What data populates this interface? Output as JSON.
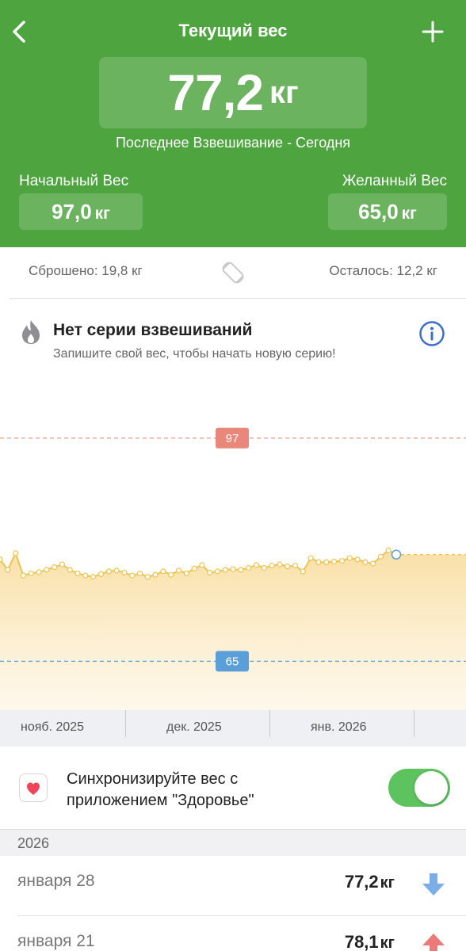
{
  "header": {
    "title": "Текущий вес",
    "current_weight": "77,2",
    "unit": "кг",
    "last_weigh_in": "Последнее Взвешивание - Сегодня",
    "start_label": "Начальный Вес",
    "start_value": "97,0",
    "goal_label": "Желанный Вес",
    "goal_value": "65,0"
  },
  "stats": {
    "lost": "Сброшено: 19,8 кг",
    "remaining": "Осталось: 12,2 кг"
  },
  "streak": {
    "title": "Нет серии взвешиваний",
    "subtitle": "Запишите свой вес, чтобы начать новую серию!"
  },
  "chart_data": {
    "type": "area",
    "x_labels": [
      "нояб. 2025",
      "дек. 2025",
      "янв. 2026"
    ],
    "reference_lines": [
      {
        "label": "97",
        "value": 97,
        "color": "#e8877a"
      },
      {
        "label": "65",
        "value": 65,
        "color": "#5b9fd8"
      }
    ],
    "series": [
      {
        "values": [
          79.6,
          78.1,
          80.5,
          77.3,
          77.6,
          77.8,
          78.1,
          78.5,
          78.9,
          78.1,
          77.6,
          77.3,
          77.1,
          77.5,
          77.9,
          78.0,
          77.7,
          77.3,
          77.6,
          77.1,
          77.4,
          77.9,
          77.4,
          78.0,
          77.6,
          78.3,
          78.8,
          77.7,
          77.9,
          78.1,
          78.2,
          78.1,
          78.4,
          78.8,
          78.4,
          78.7,
          78.9,
          78.6,
          78.7,
          77.9,
          79.8,
          79.2,
          79.2,
          79.3,
          79.4,
          79.8,
          79.6,
          79.2,
          79.0,
          80.0,
          80.9,
          80.3
        ],
        "color": "#f1c34d"
      }
    ],
    "current_point": 80.3,
    "ylim": [
      58,
      103
    ]
  },
  "sync": {
    "text": "Синхронизируйте вес с приложением \"Здоровье\"",
    "enabled": true
  },
  "history": {
    "year": "2026",
    "entries": [
      {
        "date": "января 28",
        "weight": "77,2",
        "unit": "кг",
        "trend": "down"
      },
      {
        "date": "января 21",
        "weight": "78,1",
        "unit": "кг",
        "trend": "up"
      }
    ]
  },
  "colors": {
    "header_green": "#4ea43f",
    "pill_green": "#6bb35e",
    "toggle_green": "#5cc35e",
    "info_blue": "#3c6fc9",
    "trend_down": "#7aaee8",
    "trend_up": "#ea7b78"
  }
}
